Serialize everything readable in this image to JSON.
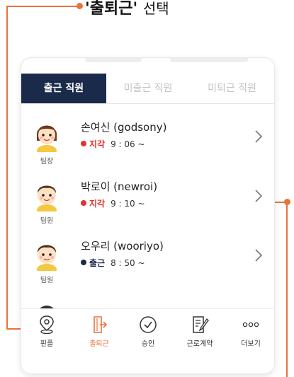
{
  "caption": {
    "highlight": "'출퇴근'",
    "suffix": "선택"
  },
  "tabs": [
    {
      "label": "출근 직원",
      "active": true
    },
    {
      "label": "미출근 직원",
      "active": false
    },
    {
      "label": "미퇴근 직원",
      "active": false
    }
  ],
  "employees": [
    {
      "name": "손여신 (godsony)",
      "role": "팀장",
      "status": "지각",
      "time": "9 : 06  ~",
      "status_color": "#e0322f",
      "avatar": "female"
    },
    {
      "name": "박로이 (newroi)",
      "role": "팀원",
      "status": "지각",
      "time": "9 : 10  ~",
      "status_color": "#e0322f",
      "avatar": "male"
    },
    {
      "name": "오우리 (wooriyo)",
      "role": "팀원",
      "status": "출근",
      "time": "8 : 50  ~",
      "status_color": "#1a2a4a",
      "avatar": "male"
    }
  ],
  "nav": [
    {
      "label": "핀플",
      "icon": "location-pin-icon",
      "active": false
    },
    {
      "label": "출퇴근",
      "icon": "door-exit-icon",
      "active": true
    },
    {
      "label": "승인",
      "icon": "check-circle-icon",
      "active": false
    },
    {
      "label": "근로계약",
      "icon": "contract-edit-icon",
      "active": false
    },
    {
      "label": "더보기",
      "icon": "more-dots-icon",
      "active": false
    }
  ],
  "colors": {
    "accent": "#e8743b",
    "tab_active": "#1a2a4a",
    "late": "#e0322f",
    "in": "#1a2a4a"
  }
}
